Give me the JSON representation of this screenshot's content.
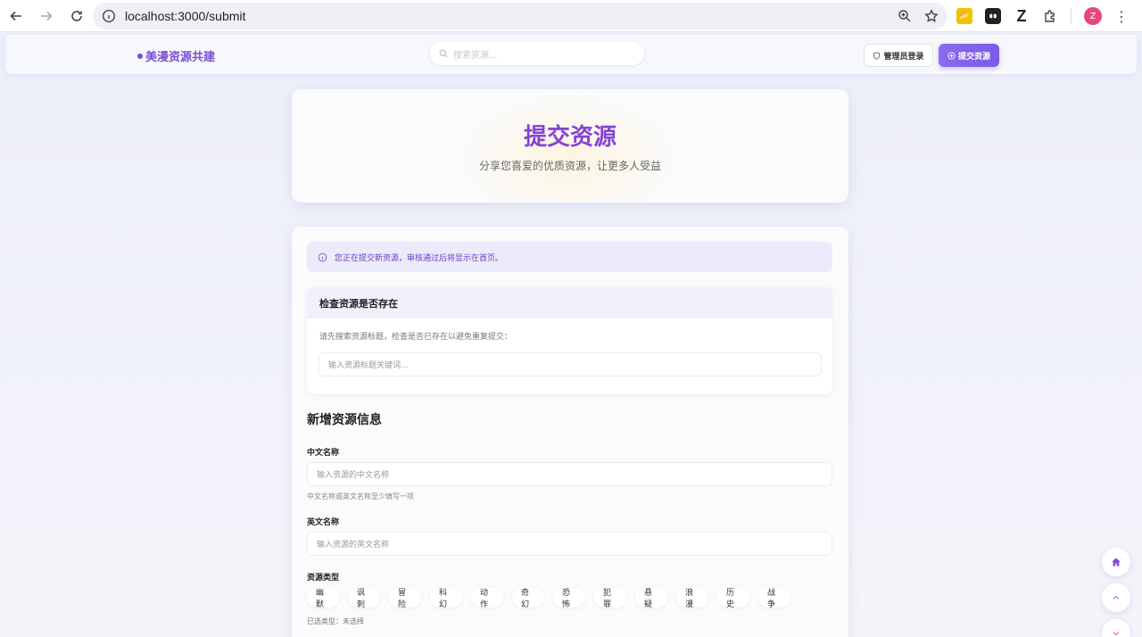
{
  "browser": {
    "url": "localhost:3000/submit",
    "avatar_letter": "Z",
    "ext_folder": "📂",
    "ext_z": "Z"
  },
  "header": {
    "brand": "美漫资源共建",
    "search_placeholder": "搜索资源...",
    "admin_login": "管理员登录",
    "submit_resource": "提交资源"
  },
  "hero": {
    "title": "提交资源",
    "subtitle": "分享您喜爱的优质资源，让更多人受益"
  },
  "form": {
    "notice": "您正在提交新资源，审核通过后将显示在首页。",
    "check": {
      "title": "检查资源是否存在",
      "hint": "请先搜索资源标题，检查是否已存在以避免重复提交：",
      "placeholder": "输入资源标题关键词..."
    },
    "section_title": "新增资源信息",
    "cn_name": {
      "label": "中文名称",
      "placeholder": "输入资源的中文名称",
      "hint": "中文名称或英文名称至少填写一项"
    },
    "en_name": {
      "label": "英文名称",
      "placeholder": "输入资源的英文名称"
    },
    "types": {
      "label": "资源类型",
      "options": [
        "幽默",
        "讽刺",
        "冒险",
        "科幻",
        "动作",
        "奇幻",
        "恐怖",
        "犯罪",
        "悬疑",
        "浪漫",
        "历史",
        "战争"
      ],
      "selected_text": "已选类型：未选择"
    }
  },
  "colors": {
    "accent": "#7b5ae6",
    "brand": "#7b4fd6",
    "hero_title": "#8544d6"
  },
  "icons": {
    "fab_home": "home-icon",
    "fab_up": "chevron-up-icon",
    "fab_down": "chevron-down-icon"
  }
}
